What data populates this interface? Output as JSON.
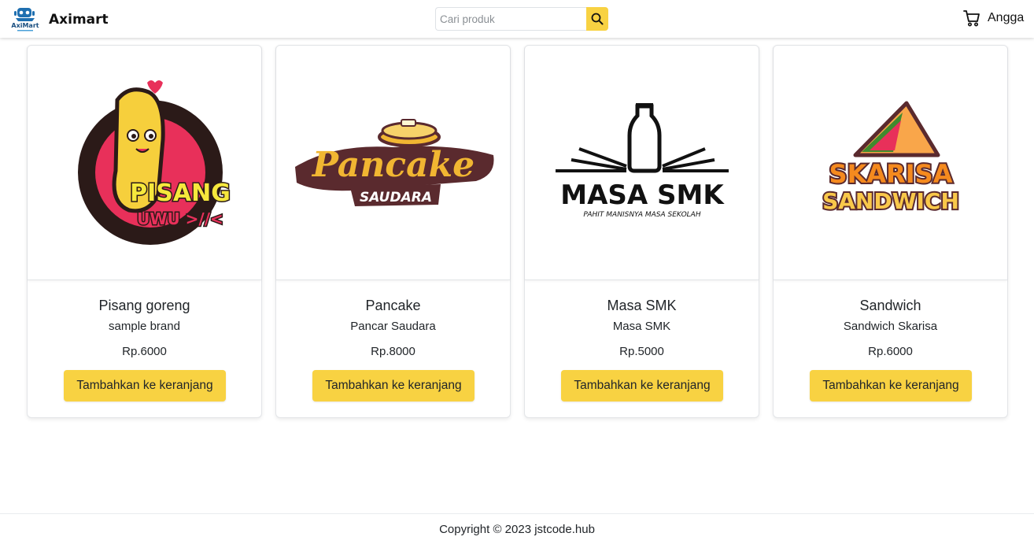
{
  "navbar": {
    "brand_name": "Aximart",
    "logo_text": "AxiMart",
    "search_placeholder": "Cari produk",
    "username": "Angga"
  },
  "products": [
    {
      "name": "Pisang goreng",
      "brand": "sample brand",
      "price": "Rp.6000",
      "button_label": "Tambahkan ke keranjang",
      "logo_lines": [
        "PISANG",
        "UWU >//<"
      ]
    },
    {
      "name": "Pancake",
      "brand": "Pancar Saudara",
      "price": "Rp.8000",
      "button_label": "Tambahkan ke keranjang",
      "logo_lines": [
        "Pancake",
        "SAUDARA"
      ]
    },
    {
      "name": "Masa SMK",
      "brand": "Masa SMK",
      "price": "Rp.5000",
      "button_label": "Tambahkan ke keranjang",
      "logo_lines": [
        "MASA SMK",
        "PAHIT MANISNYA MASA SEKOLAH"
      ]
    },
    {
      "name": "Sandwich",
      "brand": "Sandwich Skarisa",
      "price": "Rp.6000",
      "button_label": "Tambahkan ke keranjang",
      "logo_lines": [
        "SKARISA",
        "SANDWICH"
      ]
    }
  ],
  "footer": {
    "text": "Copyright © 2023 jstcode.hub"
  },
  "colors": {
    "accent": "#f8d242",
    "text": "#212529",
    "border": "#e3e5e8"
  }
}
